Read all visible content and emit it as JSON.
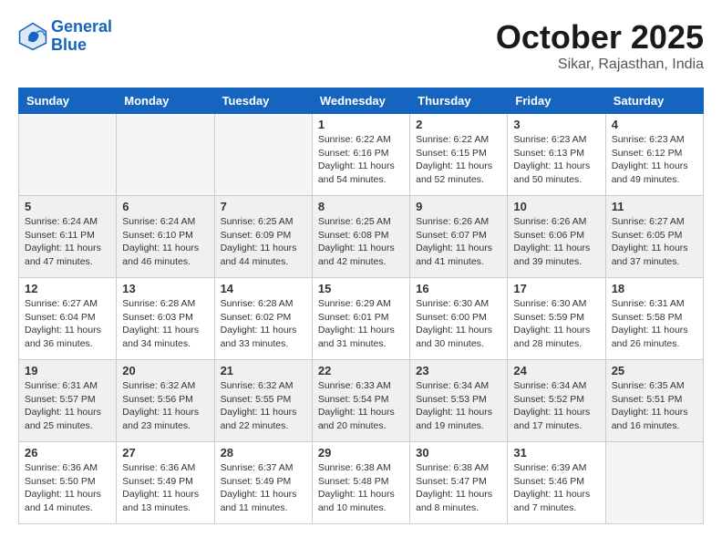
{
  "header": {
    "logo_line1": "General",
    "logo_line2": "Blue",
    "month": "October 2025",
    "location": "Sikar, Rajasthan, India"
  },
  "days_of_week": [
    "Sunday",
    "Monday",
    "Tuesday",
    "Wednesday",
    "Thursday",
    "Friday",
    "Saturday"
  ],
  "weeks": [
    [
      {
        "day": "",
        "content": "",
        "empty": true
      },
      {
        "day": "",
        "content": "",
        "empty": true
      },
      {
        "day": "",
        "content": "",
        "empty": true
      },
      {
        "day": "1",
        "content": "Sunrise: 6:22 AM\nSunset: 6:16 PM\nDaylight: 11 hours\nand 54 minutes."
      },
      {
        "day": "2",
        "content": "Sunrise: 6:22 AM\nSunset: 6:15 PM\nDaylight: 11 hours\nand 52 minutes."
      },
      {
        "day": "3",
        "content": "Sunrise: 6:23 AM\nSunset: 6:13 PM\nDaylight: 11 hours\nand 50 minutes."
      },
      {
        "day": "4",
        "content": "Sunrise: 6:23 AM\nSunset: 6:12 PM\nDaylight: 11 hours\nand 49 minutes."
      }
    ],
    [
      {
        "day": "5",
        "content": "Sunrise: 6:24 AM\nSunset: 6:11 PM\nDaylight: 11 hours\nand 47 minutes.",
        "shaded": true
      },
      {
        "day": "6",
        "content": "Sunrise: 6:24 AM\nSunset: 6:10 PM\nDaylight: 11 hours\nand 46 minutes.",
        "shaded": true
      },
      {
        "day": "7",
        "content": "Sunrise: 6:25 AM\nSunset: 6:09 PM\nDaylight: 11 hours\nand 44 minutes.",
        "shaded": true
      },
      {
        "day": "8",
        "content": "Sunrise: 6:25 AM\nSunset: 6:08 PM\nDaylight: 11 hours\nand 42 minutes.",
        "shaded": true
      },
      {
        "day": "9",
        "content": "Sunrise: 6:26 AM\nSunset: 6:07 PM\nDaylight: 11 hours\nand 41 minutes.",
        "shaded": true
      },
      {
        "day": "10",
        "content": "Sunrise: 6:26 AM\nSunset: 6:06 PM\nDaylight: 11 hours\nand 39 minutes.",
        "shaded": true
      },
      {
        "day": "11",
        "content": "Sunrise: 6:27 AM\nSunset: 6:05 PM\nDaylight: 11 hours\nand 37 minutes.",
        "shaded": true
      }
    ],
    [
      {
        "day": "12",
        "content": "Sunrise: 6:27 AM\nSunset: 6:04 PM\nDaylight: 11 hours\nand 36 minutes."
      },
      {
        "day": "13",
        "content": "Sunrise: 6:28 AM\nSunset: 6:03 PM\nDaylight: 11 hours\nand 34 minutes."
      },
      {
        "day": "14",
        "content": "Sunrise: 6:28 AM\nSunset: 6:02 PM\nDaylight: 11 hours\nand 33 minutes."
      },
      {
        "day": "15",
        "content": "Sunrise: 6:29 AM\nSunset: 6:01 PM\nDaylight: 11 hours\nand 31 minutes."
      },
      {
        "day": "16",
        "content": "Sunrise: 6:30 AM\nSunset: 6:00 PM\nDaylight: 11 hours\nand 30 minutes."
      },
      {
        "day": "17",
        "content": "Sunrise: 6:30 AM\nSunset: 5:59 PM\nDaylight: 11 hours\nand 28 minutes."
      },
      {
        "day": "18",
        "content": "Sunrise: 6:31 AM\nSunset: 5:58 PM\nDaylight: 11 hours\nand 26 minutes."
      }
    ],
    [
      {
        "day": "19",
        "content": "Sunrise: 6:31 AM\nSunset: 5:57 PM\nDaylight: 11 hours\nand 25 minutes.",
        "shaded": true
      },
      {
        "day": "20",
        "content": "Sunrise: 6:32 AM\nSunset: 5:56 PM\nDaylight: 11 hours\nand 23 minutes.",
        "shaded": true
      },
      {
        "day": "21",
        "content": "Sunrise: 6:32 AM\nSunset: 5:55 PM\nDaylight: 11 hours\nand 22 minutes.",
        "shaded": true
      },
      {
        "day": "22",
        "content": "Sunrise: 6:33 AM\nSunset: 5:54 PM\nDaylight: 11 hours\nand 20 minutes.",
        "shaded": true
      },
      {
        "day": "23",
        "content": "Sunrise: 6:34 AM\nSunset: 5:53 PM\nDaylight: 11 hours\nand 19 minutes.",
        "shaded": true
      },
      {
        "day": "24",
        "content": "Sunrise: 6:34 AM\nSunset: 5:52 PM\nDaylight: 11 hours\nand 17 minutes.",
        "shaded": true
      },
      {
        "day": "25",
        "content": "Sunrise: 6:35 AM\nSunset: 5:51 PM\nDaylight: 11 hours\nand 16 minutes.",
        "shaded": true
      }
    ],
    [
      {
        "day": "26",
        "content": "Sunrise: 6:36 AM\nSunset: 5:50 PM\nDaylight: 11 hours\nand 14 minutes."
      },
      {
        "day": "27",
        "content": "Sunrise: 6:36 AM\nSunset: 5:49 PM\nDaylight: 11 hours\nand 13 minutes."
      },
      {
        "day": "28",
        "content": "Sunrise: 6:37 AM\nSunset: 5:49 PM\nDaylight: 11 hours\nand 11 minutes."
      },
      {
        "day": "29",
        "content": "Sunrise: 6:38 AM\nSunset: 5:48 PM\nDaylight: 11 hours\nand 10 minutes."
      },
      {
        "day": "30",
        "content": "Sunrise: 6:38 AM\nSunset: 5:47 PM\nDaylight: 11 hours\nand 8 minutes."
      },
      {
        "day": "31",
        "content": "Sunrise: 6:39 AM\nSunset: 5:46 PM\nDaylight: 11 hours\nand 7 minutes."
      },
      {
        "day": "",
        "content": "",
        "empty": true
      }
    ]
  ]
}
